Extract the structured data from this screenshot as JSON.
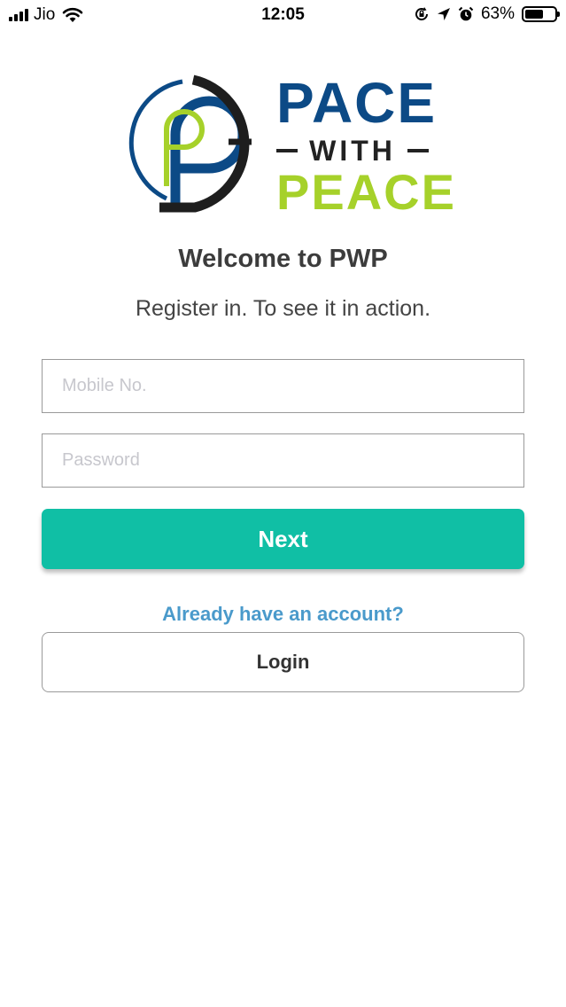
{
  "status_bar": {
    "carrier": "Jio",
    "time": "12:05",
    "battery_percent_label": "63%",
    "battery_level": 0.63,
    "icons": [
      "signal-icon",
      "wifi-icon",
      "orientation-lock-icon",
      "location-icon",
      "alarm-icon",
      "battery-icon"
    ]
  },
  "logo": {
    "line1": "PACE",
    "line2": "WITH",
    "line3": "PEACE",
    "colors": {
      "blue": "#0c4a86",
      "green": "#a6d12a",
      "dark": "#222222"
    }
  },
  "welcome": {
    "title": "Welcome to PWP",
    "subtitle": "Register in. To see it in action."
  },
  "form": {
    "mobile_placeholder": "Mobile No.",
    "mobile_value": "",
    "password_placeholder": "Password",
    "password_value": "",
    "next_label": "Next",
    "next_color": "#10bfa5"
  },
  "account": {
    "prompt": "Already have an account?",
    "login_label": "Login",
    "prompt_color": "#4a9acb"
  }
}
